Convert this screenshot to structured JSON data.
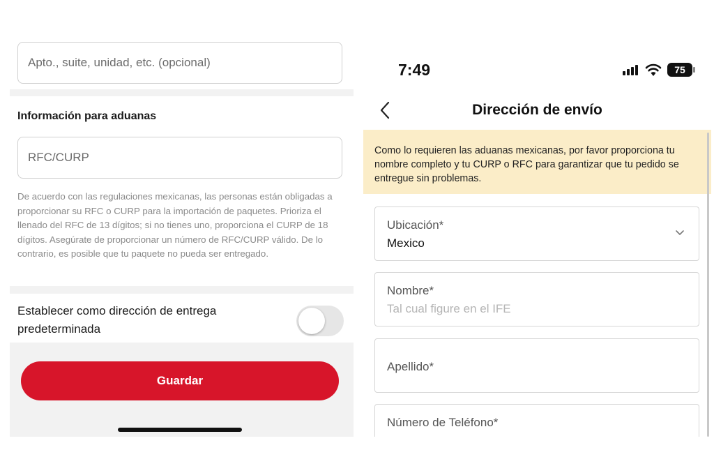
{
  "left": {
    "apt_placeholder": "Apto., suite, unidad, etc. (opcional)",
    "customs_title": "Información para aduanas",
    "rfc_placeholder": "RFC/CURP",
    "customs_note": "De acuerdo con las regulaciones mexicanas, las personas están obligadas a proporcionar su RFC o CURP para la importación de paquetes. Prioriza el llenado del RFC de 13 dígitos; si no tienes uno, proporciona el CURP de 18 dígitos. Asegúrate de proporcionar un número de RFC/CURP válido. De lo contrario, es posible que tu paquete no pueda ser entregado.",
    "default_label": "Establecer como dirección de entrega predeterminada",
    "default_toggle_on": false,
    "save_label": "Guardar",
    "accent_color": "#d7152a"
  },
  "right": {
    "status": {
      "time": "7:49",
      "battery": "75"
    },
    "nav_title": "Dirección de envío",
    "back_icon": "chevron-left-icon",
    "banner_text": "Como lo requieren las aduanas mexicanas, por favor proporciona tu nombre completo y tu CURP o RFC para garantizar que tu pedido se entregue sin problemas.",
    "banner_color": "#fbedc8",
    "fields": {
      "location": {
        "label": "Ubicación*",
        "value": "Mexico"
      },
      "name": {
        "label": "Nombre*",
        "placeholder": "Tal cual figure en el IFE"
      },
      "last_name": {
        "label": "Apellido*"
      },
      "phone": {
        "label": "Número de Teléfono*"
      }
    }
  }
}
